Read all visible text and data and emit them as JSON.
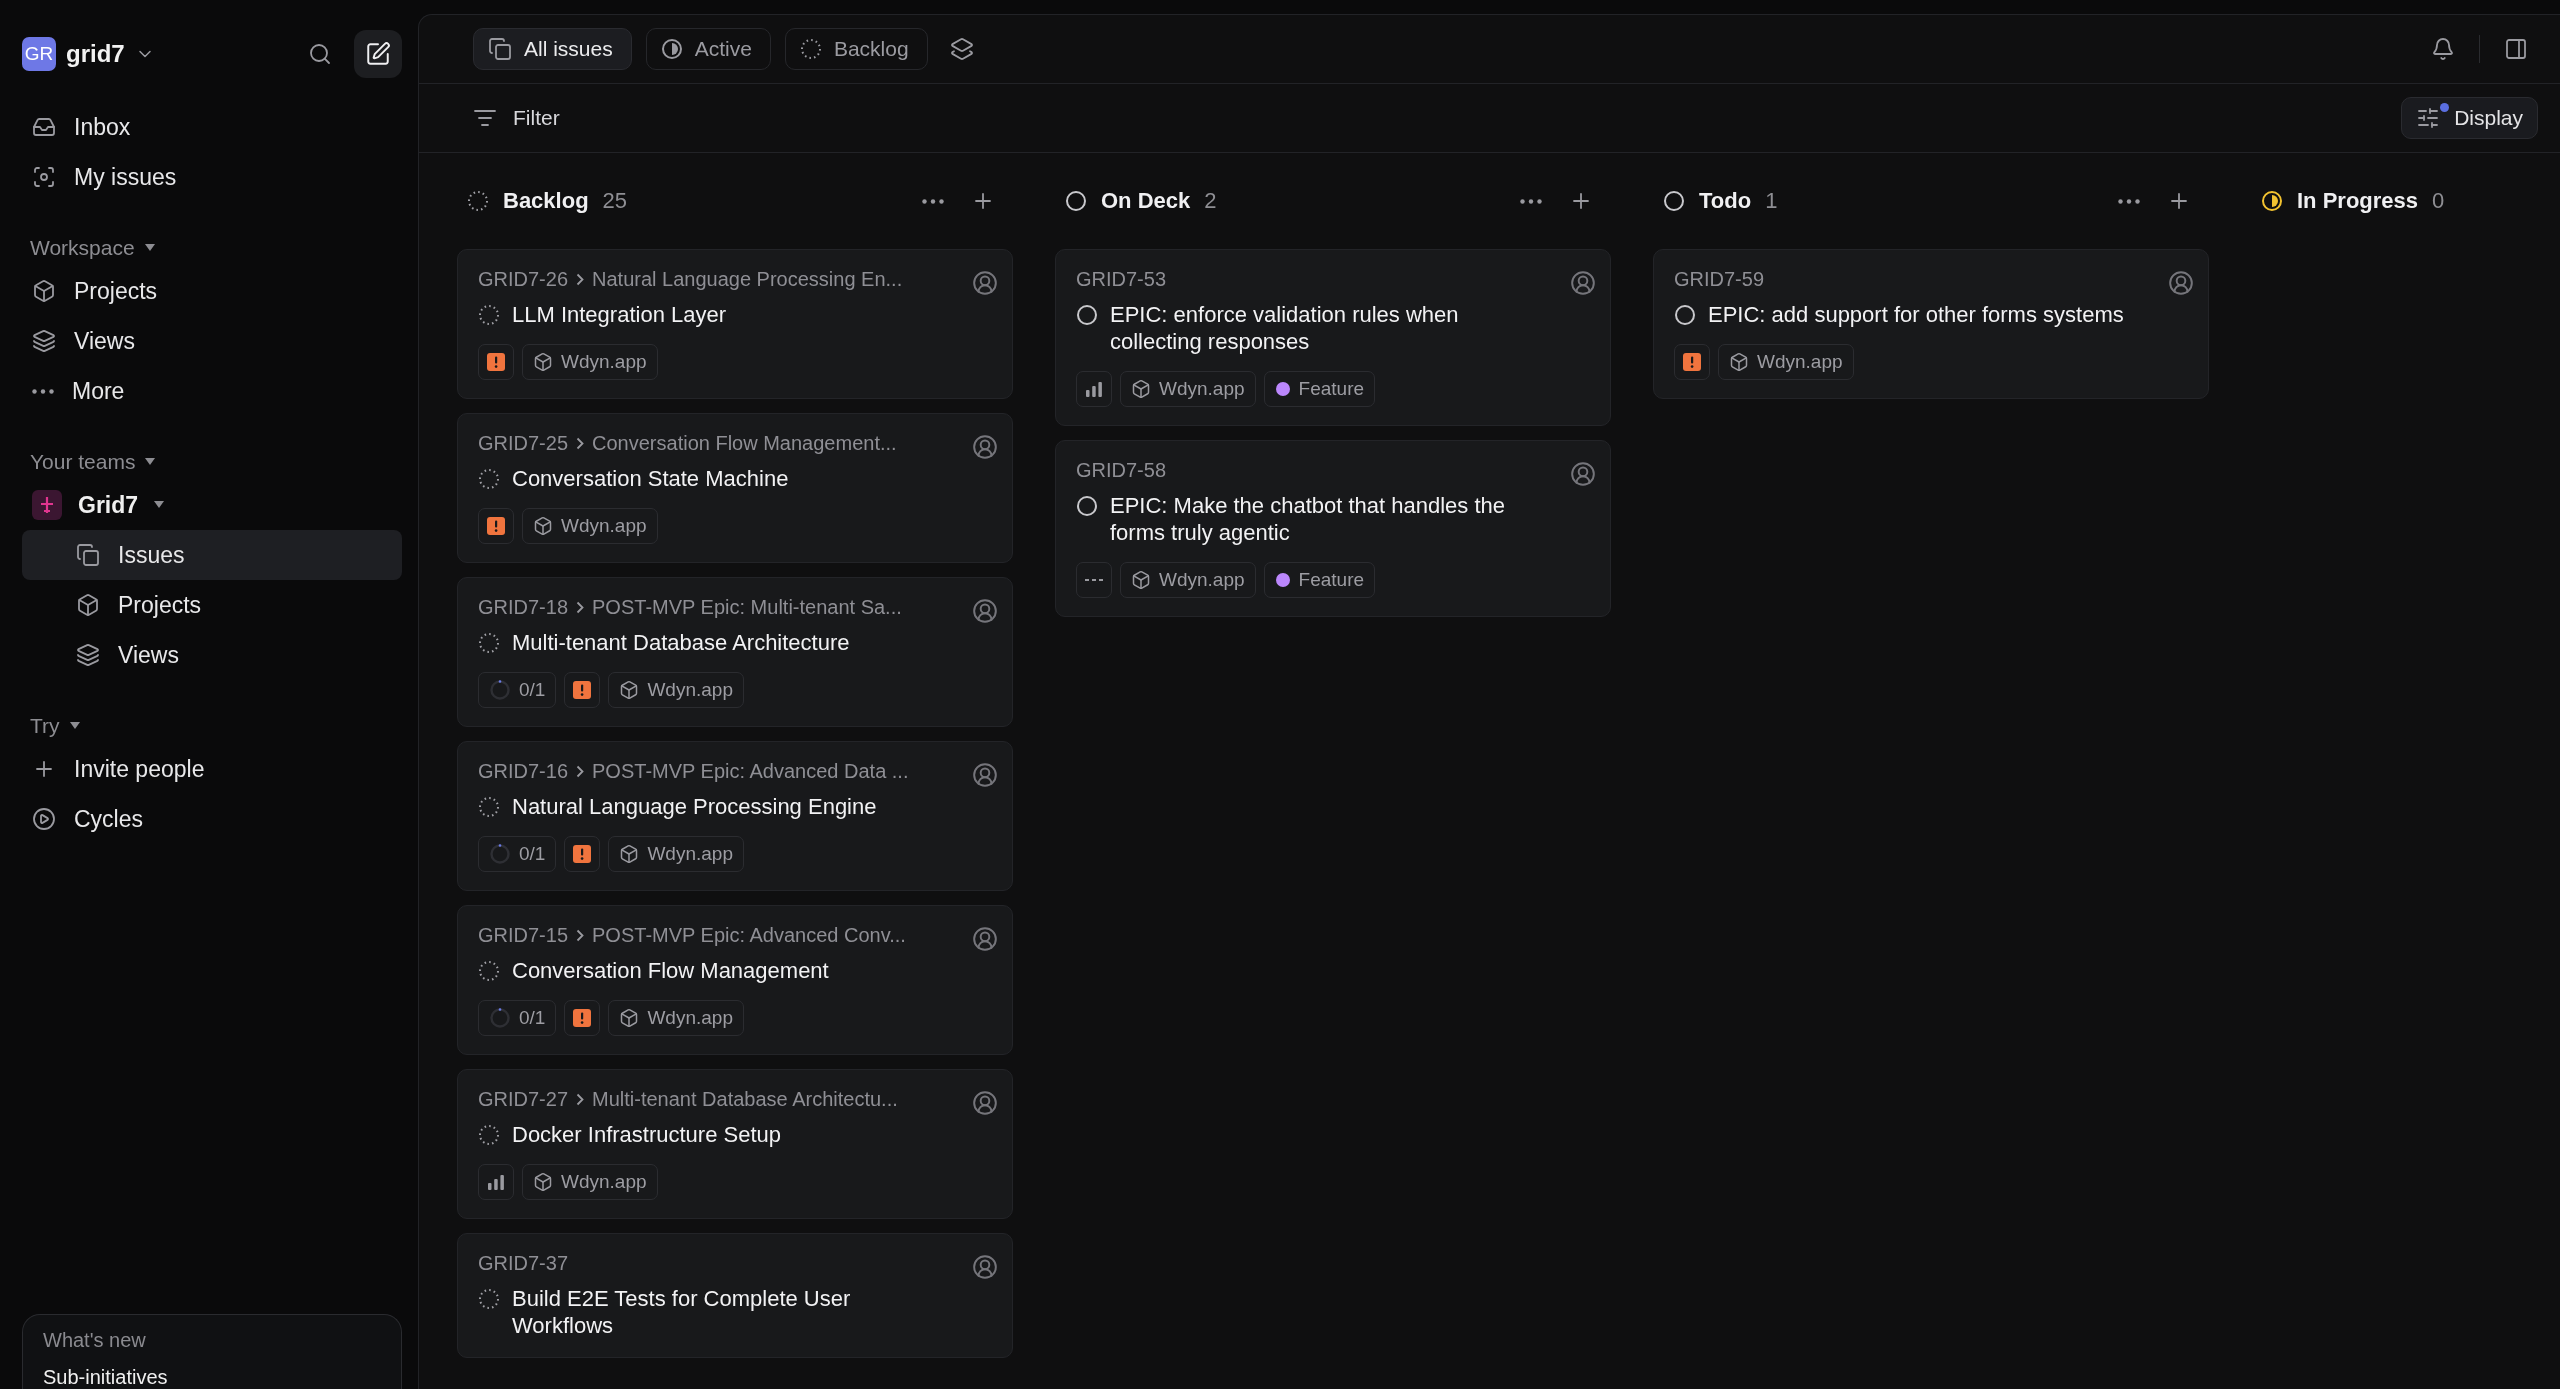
{
  "workspace": {
    "initials": "GR",
    "name": "grid7"
  },
  "nav": [
    {
      "label": "Inbox"
    },
    {
      "label": "My issues"
    }
  ],
  "sections": [
    {
      "title": "Workspace",
      "items": [
        {
          "label": "Projects",
          "selected": false
        },
        {
          "label": "Views",
          "selected": false
        },
        {
          "label": "More",
          "selected": false
        }
      ]
    },
    {
      "title": "Your teams",
      "team": {
        "name": "Grid7",
        "items": [
          {
            "label": "Issues",
            "selected": true
          },
          {
            "label": "Projects",
            "selected": false
          },
          {
            "label": "Views",
            "selected": false
          }
        ]
      }
    },
    {
      "title": "Try",
      "items": [
        {
          "label": "Invite people",
          "selected": false
        },
        {
          "label": "Cycles",
          "selected": false
        }
      ]
    }
  ],
  "whats_new": {
    "heading": "What's new",
    "title": "Sub-initiatives"
  },
  "view_tabs": [
    {
      "label": "All issues",
      "selected": true
    },
    {
      "label": "Active",
      "selected": false
    },
    {
      "label": "Backlog",
      "selected": false
    }
  ],
  "filter": {
    "label": "Filter"
  },
  "display": {
    "label": "Display",
    "indicator": true
  },
  "columns": [
    {
      "title": "Backlog",
      "count": "25",
      "kind": "backlog",
      "cards": [
        {
          "id": "GRID7-26",
          "parent": "Natural Language Processing En...",
          "title": "LLM Integration Layer",
          "kind": "backlog",
          "chips": [
            {
              "kind": "urgent"
            },
            {
              "kind": "project",
              "label": "Wdyn.app"
            }
          ]
        },
        {
          "id": "GRID7-25",
          "parent": "Conversation Flow Management...",
          "title": "Conversation State Machine",
          "kind": "backlog",
          "chips": [
            {
              "kind": "urgent"
            },
            {
              "kind": "project",
              "label": "Wdyn.app"
            }
          ]
        },
        {
          "id": "GRID7-18",
          "parent": "POST-MVP Epic: Multi-tenant Sa...",
          "title": "Multi-tenant Database Architecture",
          "kind": "backlog",
          "chips": [
            {
              "kind": "progress",
              "label": "0/1"
            },
            {
              "kind": "urgent"
            },
            {
              "kind": "project",
              "label": "Wdyn.app"
            }
          ]
        },
        {
          "id": "GRID7-16",
          "parent": "POST-MVP Epic: Advanced Data ...",
          "title": "Natural Language Processing Engine",
          "kind": "backlog",
          "chips": [
            {
              "kind": "progress",
              "label": "0/1"
            },
            {
              "kind": "urgent"
            },
            {
              "kind": "project",
              "label": "Wdyn.app"
            }
          ]
        },
        {
          "id": "GRID7-15",
          "parent": "POST-MVP Epic: Advanced Conv...",
          "title": "Conversation Flow Management",
          "kind": "backlog",
          "chips": [
            {
              "kind": "progress",
              "label": "0/1"
            },
            {
              "kind": "urgent"
            },
            {
              "kind": "project",
              "label": "Wdyn.app"
            }
          ]
        },
        {
          "id": "GRID7-27",
          "parent": "Multi-tenant Database Architectu...",
          "title": "Docker Infrastructure Setup",
          "kind": "backlog",
          "chips": [
            {
              "kind": "medium"
            },
            {
              "kind": "project",
              "label": "Wdyn.app"
            }
          ]
        },
        {
          "id": "GRID7-37",
          "title": "Build E2E Tests for Complete User Workflows",
          "kind": "backlog"
        }
      ]
    },
    {
      "title": "On Deck",
      "count": "2",
      "kind": "todo",
      "cards": [
        {
          "id": "GRID7-53",
          "title": "EPIC: enforce validation rules when collecting responses",
          "kind": "todo",
          "chips": [
            {
              "kind": "medium"
            },
            {
              "kind": "project",
              "label": "Wdyn.app"
            },
            {
              "kind": "label",
              "label": "Feature",
              "color": "#bb87fc"
            }
          ]
        },
        {
          "id": "GRID7-58",
          "title": "EPIC: Make the chatbot that handles the forms truly agentic",
          "kind": "todo",
          "chips": [
            {
              "kind": "no-priority"
            },
            {
              "kind": "project",
              "label": "Wdyn.app"
            },
            {
              "kind": "label",
              "label": "Feature",
              "color": "#bb87fc"
            }
          ]
        }
      ]
    },
    {
      "title": "Todo",
      "count": "1",
      "kind": "todo",
      "cards": [
        {
          "id": "GRID7-59",
          "title": "EPIC: add support for other forms systems",
          "kind": "todo",
          "chips": [
            {
              "kind": "urgent"
            },
            {
              "kind": "project",
              "label": "Wdyn.app"
            }
          ]
        }
      ]
    },
    {
      "title": "In Progress",
      "count": "0",
      "kind": "in_progress"
    }
  ]
}
